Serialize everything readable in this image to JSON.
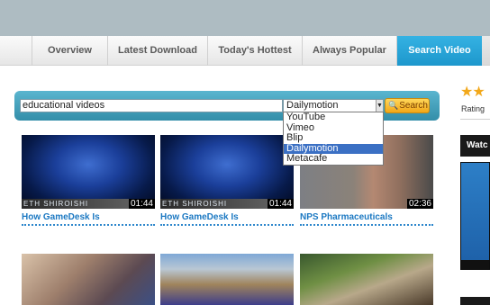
{
  "nav": {
    "items": [
      {
        "label": "Overview"
      },
      {
        "label": "Latest Download"
      },
      {
        "label": "Today's Hottest"
      },
      {
        "label": "Always Popular"
      },
      {
        "label": "Search Video"
      }
    ]
  },
  "search": {
    "query": "educational videos",
    "selected_source": "Dailymotion",
    "button_label": "Search",
    "options": [
      "YouTube",
      "Vimeo",
      "Blip",
      "Dailymotion",
      "Metacafe"
    ]
  },
  "sidebar": {
    "rating_stars": "★★",
    "rating_label": "Rating",
    "watch_label": "Watc"
  },
  "videos": [
    {
      "title": "How GameDesk Is",
      "duration": "01:44",
      "caption": "ETH SHIROISHI"
    },
    {
      "title": "How GameDesk Is",
      "duration": "01:44",
      "caption": "ETH SHIROISHI"
    },
    {
      "title": "NPS Pharmaceuticals",
      "duration": "02:36",
      "caption": ""
    }
  ],
  "colors": {
    "nav_active": "#1d97cc",
    "search_bar": "#338ea9",
    "link": "#1b78c2",
    "button": "#f2a718",
    "dropdown_selected": "#3b70c4"
  }
}
